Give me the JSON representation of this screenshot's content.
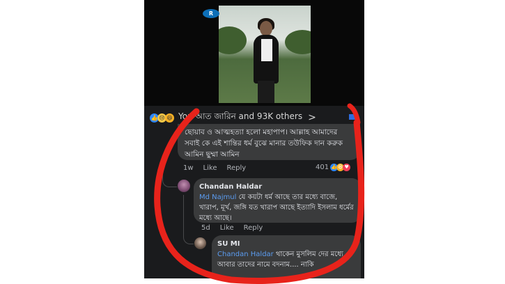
{
  "video": {
    "channel_logo": "R"
  },
  "reactions_bar": {
    "icons": [
      "like-icon",
      "sad-icon",
      "haha-icon"
    ],
    "summary": "You আত জারিন and 93K others",
    "chevron": ">"
  },
  "comments": [
    {
      "text": "ছোয়াব ও আত্মহত্যা হলো মহাপাপ। আল্লাহ আমাদের সবাই কে এই শান্তির ধর্ম বুঝে মানার তউফিক দান করুক আমিন ছুম্মা আমিন",
      "time": "1w",
      "like_label": "Like",
      "reply_label": "Reply",
      "reaction_count": "401"
    },
    {
      "author": "Chandan Haldar",
      "mention": "Md Najmul",
      "text": "যে কয়টা ধর্ম আছে তার মধ্যে বাজে, খারাপ, মূর্খ, জঙ্গি যত খারাপ আছে ইত্যাদি ইসলাম ধর্মের মধ্যে আছে।",
      "time": "5d",
      "like_label": "Like",
      "reply_label": "Reply"
    },
    {
      "author": "SU MI",
      "mention": "Chandan Haldar",
      "text": "থাকেন মুসলিম দের মধ্যে",
      "text2": "আবার তাদের নামে বদনাম.... নাকি"
    }
  ],
  "colors": {
    "annotation": "#e8231b",
    "mention": "#5b9cf0",
    "bubble": "#3a3b3c"
  }
}
